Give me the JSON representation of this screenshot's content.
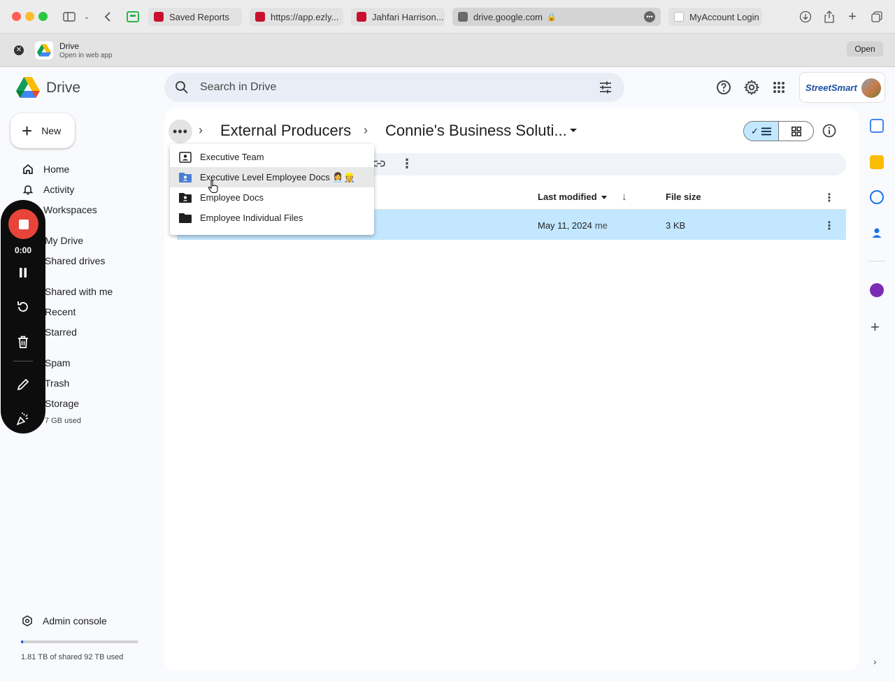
{
  "browser": {
    "tabs": [
      {
        "label": "Saved Reports"
      },
      {
        "label": "https://app.ezly..."
      },
      {
        "label": "Jahfari Harrison..."
      },
      {
        "label": "drive.google.com"
      },
      {
        "label": "MyAccount Login"
      }
    ]
  },
  "webapp": {
    "title": "Drive",
    "subtitle": "Open in web app",
    "open_label": "Open"
  },
  "header": {
    "app_name": "Drive",
    "search_placeholder": "Search in Drive",
    "account_brand": "StreetSmart"
  },
  "sidebar": {
    "new_label": "New",
    "items": [
      {
        "label": "Home",
        "icon": "home-icon"
      },
      {
        "label": "Activity",
        "icon": "bell-icon"
      },
      {
        "label": "Workspaces",
        "icon": "workspaces-icon"
      },
      {
        "label": "My Drive",
        "icon": "my-drive-icon"
      },
      {
        "label": "Shared drives",
        "icon": "shared-drives-icon"
      },
      {
        "label": "Shared with me",
        "icon": "shared-icon"
      },
      {
        "label": "Recent",
        "icon": "clock-icon"
      },
      {
        "label": "Starred",
        "icon": "star-icon"
      },
      {
        "label": "Spam",
        "icon": "spam-icon"
      },
      {
        "label": "Trash",
        "icon": "trash-icon"
      },
      {
        "label": "Storage",
        "icon": "cloud-icon"
      }
    ],
    "storage_small": "7 GB used",
    "admin_label": "Admin console",
    "storage_text": "1.81 TB of shared 92 TB used",
    "storage_fraction": 0.02
  },
  "recorder": {
    "time": "0:00"
  },
  "breadcrumb": {
    "items": [
      "External Producers",
      "Connie's Business Soluti..."
    ]
  },
  "dropdown": {
    "items": [
      {
        "label": "Executive Team",
        "icon": "contacts-folder-icon"
      },
      {
        "label": "Executive Level Employee Docs 👩‍💼👷",
        "icon": "shared-folder-icon"
      },
      {
        "label": "Employee Docs",
        "icon": "shared-folder-icon"
      },
      {
        "label": "Employee Individual Files",
        "icon": "folder-icon"
      }
    ]
  },
  "table": {
    "columns": {
      "last_modified": "Last modified",
      "file_size": "File size"
    },
    "rows": [
      {
        "modified": "May 11, 2024",
        "owner": "me",
        "size": "3 KB"
      }
    ]
  },
  "colors": {
    "selected_row": "#c2e7ff",
    "accent": "#0b57d0",
    "record": "#e8443a"
  }
}
